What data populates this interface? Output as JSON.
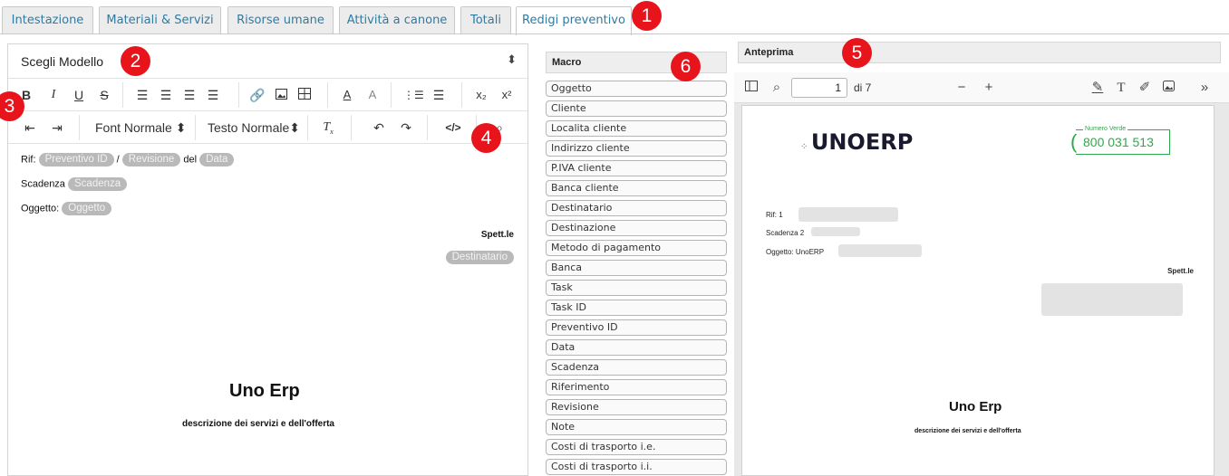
{
  "tabs": [
    {
      "label": "Intestazione"
    },
    {
      "label": "Materiali & Servizi"
    },
    {
      "label": "Risorse umane"
    },
    {
      "label": "Attività a canone"
    },
    {
      "label": "Totali"
    },
    {
      "label": "Redigi preventivo",
      "active": true
    }
  ],
  "badges": [
    "1",
    "2",
    "3",
    "4",
    "5",
    "6"
  ],
  "editor": {
    "model_select_label": "Scegli Modello",
    "font_select": "Font Normale",
    "text_select": "Testo Normale",
    "content": {
      "rif_label": "Rif:",
      "rif_pill_1": "Preventivo ID",
      "rif_sep": "/",
      "rif_pill_2": "Revisione",
      "rif_del": "del",
      "rif_pill_3": "Data",
      "scadenza_label": "Scadenza",
      "scadenza_pill": "Scadenza",
      "oggetto_label": "Oggetto:",
      "oggetto_pill": "Oggetto",
      "spett": "Spett.le",
      "destinatario_pill": "Destinatario",
      "title": "Uno Erp",
      "subtitle": "descrizione dei servizi e dell'offerta"
    }
  },
  "macro": {
    "header": "Macro",
    "items": [
      "Oggetto",
      "Cliente",
      "Localita cliente",
      "Indirizzo cliente",
      "P.IVA cliente",
      "Banca cliente",
      "Destinatario",
      "Destinazione",
      "Metodo di pagamento",
      "Banca",
      "Task",
      "Task ID",
      "Preventivo ID",
      "Data",
      "Scadenza",
      "Riferimento",
      "Revisione",
      "Note",
      "Costi di trasporto i.e.",
      "Costi di trasporto i.i."
    ]
  },
  "preview": {
    "header": "Anteprima",
    "page_current": "1",
    "page_of": "di 7",
    "logo": "UNOERP",
    "verde_label": "Numero Verde",
    "verde_number": "800 031 513",
    "rif": "Rif: 1",
    "scadenza": "Scadenza 2",
    "oggetto": "Oggetto: UnoERP",
    "spett": "Spett.le",
    "title": "Uno Erp",
    "subtitle": "descrizione dei servizi e dell'offerta"
  },
  "colors": {
    "tab_text": "#2e7ba3",
    "badge": "#e8141c",
    "pill": "#b9b9b9",
    "verde": "#2ea84a"
  }
}
